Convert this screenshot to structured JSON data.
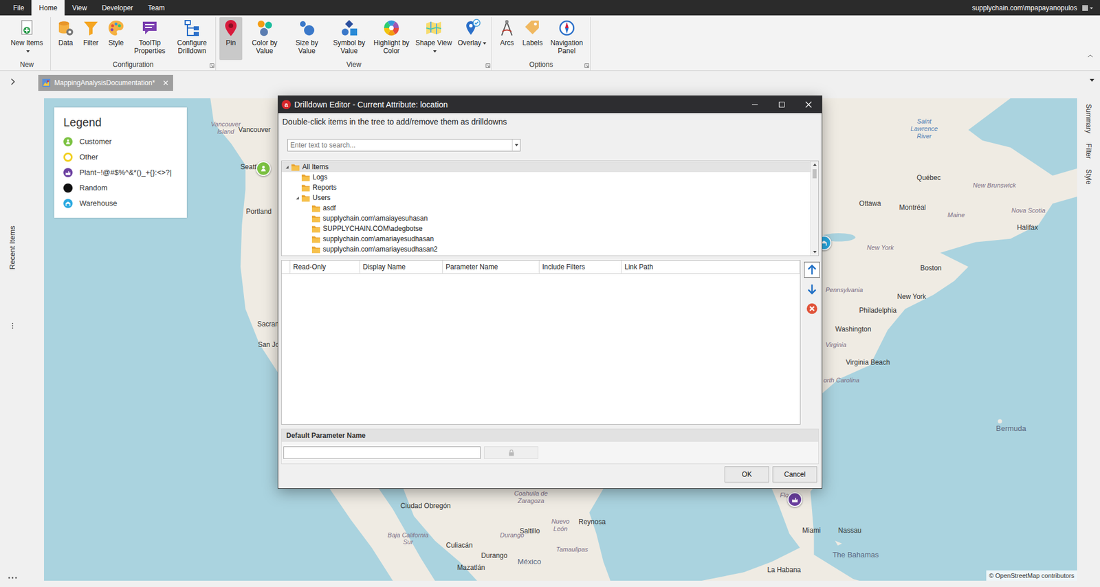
{
  "menu": {
    "tabs": [
      {
        "label": "File",
        "selected": false
      },
      {
        "label": "Home",
        "selected": true
      },
      {
        "label": "View",
        "selected": false
      },
      {
        "label": "Developer",
        "selected": false
      },
      {
        "label": "Team",
        "selected": false
      }
    ],
    "user": "supplychain.com\\mpapayanopulos"
  },
  "ribbon": {
    "groups": [
      {
        "label": "New",
        "buttons": [
          {
            "label": "New Items",
            "selected": false,
            "dropdown": true
          }
        ]
      },
      {
        "label": "Configuration",
        "buttons": [
          {
            "label": "Data",
            "selected": false,
            "dropdown": false
          },
          {
            "label": "Filter",
            "selected": false,
            "dropdown": false
          },
          {
            "label": "Style",
            "selected": false,
            "dropdown": false
          },
          {
            "label": "ToolTip Properties",
            "selected": false,
            "dropdown": false
          },
          {
            "label": "Configure Drilldown",
            "selected": false,
            "dropdown": false
          }
        ]
      },
      {
        "label": "View",
        "buttons": [
          {
            "label": "Pin",
            "selected": true,
            "dropdown": false
          },
          {
            "label": "Color by Value",
            "selected": false,
            "dropdown": false
          },
          {
            "label": "Size by Value",
            "selected": false,
            "dropdown": false
          },
          {
            "label": "Symbol by Value",
            "selected": false,
            "dropdown": false
          },
          {
            "label": "Highlight by Color",
            "selected": false,
            "dropdown": false
          },
          {
            "label": "Shape View",
            "selected": false,
            "dropdown": true
          },
          {
            "label": "Overlay",
            "selected": false,
            "dropdown": true
          }
        ]
      },
      {
        "label": "Options",
        "buttons": [
          {
            "label": "Arcs",
            "selected": false,
            "dropdown": false
          },
          {
            "label": "Labels",
            "selected": false,
            "dropdown": false
          },
          {
            "label": "Navigation Panel",
            "selected": false,
            "dropdown": false
          }
        ]
      }
    ]
  },
  "side_panel": {
    "label": "Recent Items"
  },
  "document_tabs": [
    {
      "label": "MappingAnalysisDocumentation*",
      "selected": true
    }
  ],
  "right_panel": {
    "tabs": [
      {
        "label": "Summary"
      },
      {
        "label": "Filter"
      },
      {
        "label": "Style"
      }
    ]
  },
  "map": {
    "legend": {
      "title": "Legend",
      "items": [
        {
          "label": "Customer",
          "kind": "icon",
          "color": "#7cc242"
        },
        {
          "label": "Other",
          "kind": "ring",
          "color": "#f1cf1e"
        },
        {
          "label": "Plant~!@#$%^&*()_+{}:<>?|",
          "kind": "icon",
          "color": "#6b3fa0"
        },
        {
          "label": "Random",
          "kind": "dot",
          "color": "#111111"
        },
        {
          "label": "Warehouse",
          "kind": "icon",
          "color": "#29a9e1"
        }
      ]
    },
    "pins": [
      {
        "kind": "customer",
        "color": "#7cc242"
      },
      {
        "kind": "warehouse",
        "color": "#29a9e1"
      },
      {
        "kind": "plant",
        "color": "#6b3fa0"
      }
    ],
    "labels": [
      {
        "text": "Vancouver Island",
        "kind": "region"
      },
      {
        "text": "Vancouver",
        "kind": "city"
      },
      {
        "text": "Seattl",
        "kind": "city"
      },
      {
        "text": "Portland",
        "kind": "city"
      },
      {
        "text": "Sacram",
        "kind": "city"
      },
      {
        "text": "San Jos",
        "kind": "city"
      },
      {
        "text": "Saint Lawrence River",
        "kind": "water"
      },
      {
        "text": "Québec",
        "kind": "city"
      },
      {
        "text": "New Brunswick",
        "kind": "region"
      },
      {
        "text": "Ottawa",
        "kind": "city"
      },
      {
        "text": "Montréal",
        "kind": "city"
      },
      {
        "text": "Nova Scotia",
        "kind": "region"
      },
      {
        "text": "Maine",
        "kind": "region"
      },
      {
        "text": "Halifax",
        "kind": "city"
      },
      {
        "text": "New York",
        "kind": "region"
      },
      {
        "text": "Boston",
        "kind": "city"
      },
      {
        "text": "Pennsylvania",
        "kind": "region"
      },
      {
        "text": "New York",
        "kind": "city"
      },
      {
        "text": "Philadelphia",
        "kind": "city"
      },
      {
        "text": "Washington",
        "kind": "city"
      },
      {
        "text": "Virginia",
        "kind": "region"
      },
      {
        "text": "Virginia Beach",
        "kind": "city"
      },
      {
        "text": "orth Carolina",
        "kind": "region"
      },
      {
        "text": "Bermuda",
        "kind": "country"
      },
      {
        "text": "Coahuila de Zaragoza",
        "kind": "region"
      },
      {
        "text": "Ciudad Obregón",
        "kind": "city"
      },
      {
        "text": "Nuevo León",
        "kind": "region"
      },
      {
        "text": "Reynosa",
        "kind": "city"
      },
      {
        "text": "Saltillo",
        "kind": "city"
      },
      {
        "text": "Baja California Sur",
        "kind": "region"
      },
      {
        "text": "Durango",
        "kind": "region"
      },
      {
        "text": "Tamaulipas",
        "kind": "region"
      },
      {
        "text": "Culiacán",
        "kind": "city"
      },
      {
        "text": "Durango",
        "kind": "city"
      },
      {
        "text": "México",
        "kind": "country"
      },
      {
        "text": "Mazatlán",
        "kind": "city"
      },
      {
        "text": "Flo",
        "kind": "region"
      },
      {
        "text": "Miami",
        "kind": "city"
      },
      {
        "text": "Nassau",
        "kind": "city"
      },
      {
        "text": "The Bahamas",
        "kind": "country"
      },
      {
        "text": "La Habana",
        "kind": "city"
      }
    ],
    "attribution": "© OpenStreetMap contributors"
  },
  "dialog": {
    "app_icon": "a",
    "title": "Drilldown Editor - Current Attribute: location",
    "instruction": "Double-click items in the tree to add/remove them as drilldowns",
    "search": {
      "placeholder": "Enter text to search..."
    },
    "tree": [
      {
        "label": "All Items",
        "expandable": true,
        "expanded": true,
        "selected": true,
        "children": [
          {
            "label": "Logs",
            "expandable": false,
            "expanded": false,
            "selected": false,
            "children": []
          },
          {
            "label": "Reports",
            "expandable": false,
            "expanded": false,
            "selected": false,
            "children": []
          },
          {
            "label": "Users",
            "expandable": true,
            "expanded": true,
            "selected": false,
            "children": [
              {
                "label": "asdf",
                "expandable": false,
                "expanded": false,
                "selected": false,
                "children": []
              },
              {
                "label": "supplychain.com\\amaiayesuhasan",
                "expandable": false,
                "expanded": false,
                "selected": false,
                "children": []
              },
              {
                "label": "SUPPLYCHAIN.COM\\adegbotse",
                "expandable": false,
                "expanded": false,
                "selected": false,
                "children": []
              },
              {
                "label": "supplychain.com\\amariayesudhasan",
                "expandable": false,
                "expanded": false,
                "selected": false,
                "children": []
              },
              {
                "label": "supplychain.com\\amariayesudhasan2",
                "expandable": false,
                "expanded": false,
                "selected": false,
                "children": []
              }
            ]
          }
        ]
      }
    ],
    "tree_scrollbar": {
      "level": 0.12
    },
    "grid": {
      "columns": [
        "Read-Only",
        "Display Name",
        "Parameter Name",
        "Include Filters",
        "Link Path"
      ],
      "rows": []
    },
    "arrange_buttons": [
      {
        "kind": "up",
        "focused": true
      },
      {
        "kind": "down",
        "focused": false
      },
      {
        "kind": "remove",
        "focused": false
      }
    ],
    "default_parameter": {
      "label": "Default Parameter Name",
      "value": "",
      "lock_disabled": true
    },
    "buttons": [
      {
        "label": "OK"
      },
      {
        "label": "Cancel"
      }
    ]
  }
}
